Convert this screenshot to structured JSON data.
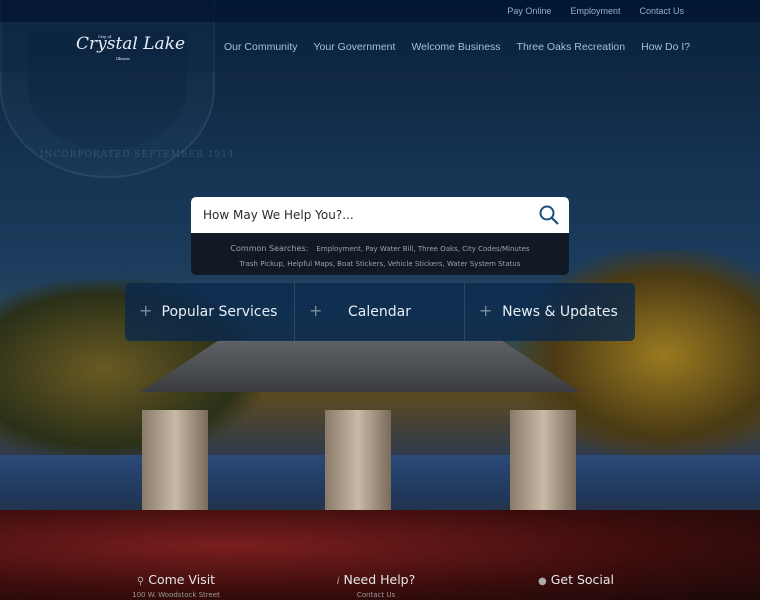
{
  "top_links": [
    "Pay Online",
    "Employment",
    "Contact Us"
  ],
  "logo": {
    "prefix": "City of",
    "name": "Crystal Lake",
    "state": "Illinois"
  },
  "seal_text": "INCORPORATED SEPTEMBER 1914",
  "nav": [
    "Our Community",
    "Your Government",
    "Welcome Business",
    "Three Oaks Recreation",
    "How Do I?"
  ],
  "search": {
    "placeholder": "How May We Help You?...",
    "common_label": "Common Searches:",
    "common": [
      "Employment",
      "Pay Water Bill",
      "Three Oaks",
      "City Codes/Minutes",
      "Trash Pickup",
      "Helpful Maps",
      "Boat Stickers",
      "Vehicle Stickers",
      "Water System Status"
    ]
  },
  "tiles": [
    "Popular Services",
    "Calendar",
    "News & Updates"
  ],
  "footer": [
    {
      "icon": "map-pin-icon",
      "title": "Come Visit",
      "sub": "100 W. Woodstock Street"
    },
    {
      "icon": "info-icon",
      "title": "Need Help?",
      "sub": "Contact Us"
    },
    {
      "icon": "chat-icon",
      "title": "Get Social",
      "sub": ""
    }
  ]
}
